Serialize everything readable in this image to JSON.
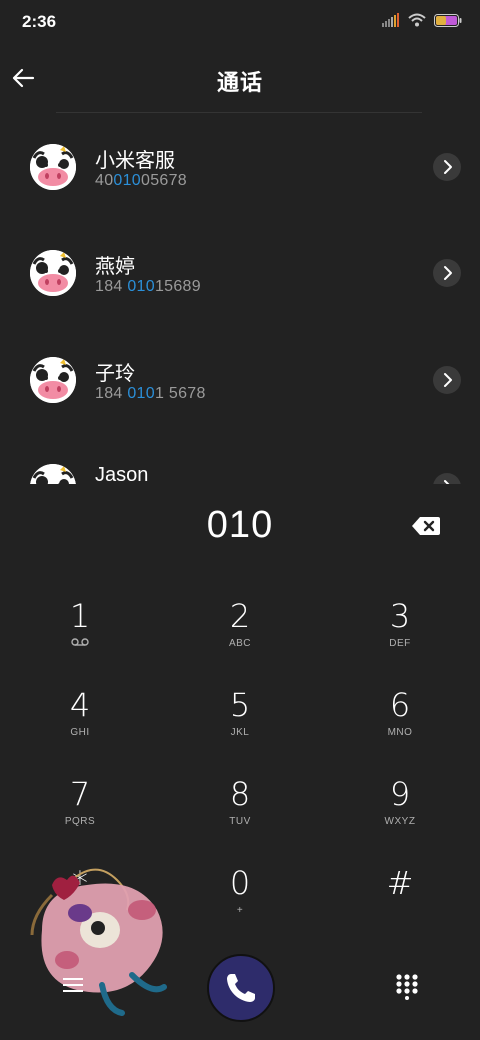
{
  "status_bar": {
    "time": "2:36"
  },
  "header": {
    "title": "通话"
  },
  "contacts": [
    {
      "name": "小米客服",
      "number_parts": [
        "40",
        "010",
        "05678"
      ]
    },
    {
      "name": "燕婷",
      "number_parts": [
        "184 ",
        "010",
        "15689"
      ]
    },
    {
      "name": "子玲",
      "number_parts": [
        "184 ",
        "010",
        "1 5678"
      ]
    },
    {
      "name": "Jason",
      "number_parts": [
        "",
        "",
        ""
      ]
    }
  ],
  "dialer": {
    "input": "010",
    "keys": [
      {
        "digit": "1",
        "letters": ""
      },
      {
        "digit": "2",
        "letters": "ABC"
      },
      {
        "digit": "3",
        "letters": "DEF"
      },
      {
        "digit": "4",
        "letters": "GHI"
      },
      {
        "digit": "5",
        "letters": "JKL"
      },
      {
        "digit": "6",
        "letters": "MNO"
      },
      {
        "digit": "7",
        "letters": "PQRS"
      },
      {
        "digit": "8",
        "letters": "TUV"
      },
      {
        "digit": "9",
        "letters": "WXYZ"
      },
      {
        "digit": "*",
        "letters": ","
      },
      {
        "digit": "0",
        "letters": "+"
      },
      {
        "digit": "#",
        "letters": ""
      }
    ]
  },
  "colors": {
    "background": "#222222",
    "highlight": "#2b8fd8",
    "call_button": "#2e2c6b"
  },
  "icons": {
    "back": "arrow-left-icon",
    "detail": "chevron-right-icon",
    "backspace": "backspace-icon",
    "voicemail": "voicemail-icon",
    "menu": "menu-icon",
    "call": "phone-icon",
    "dialpad": "dialpad-icon"
  }
}
